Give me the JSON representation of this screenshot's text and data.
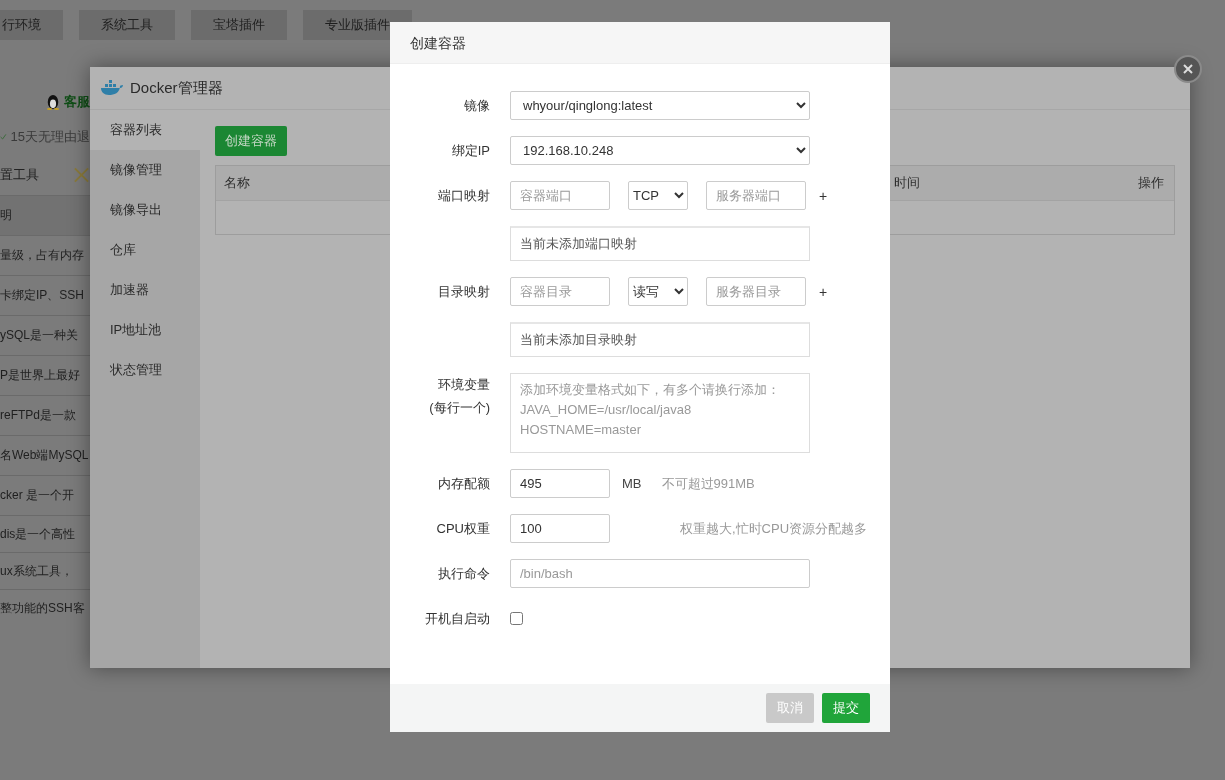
{
  "background_page": {
    "tabs": [
      {
        "label": "行环境"
      },
      {
        "label": "系统工具"
      },
      {
        "label": "宝塔插件"
      },
      {
        "label": "专业版插件"
      }
    ],
    "support": "客服",
    "refund": "15天无理由退",
    "tools": "置工具",
    "column_header": "明",
    "rows": [
      "量级，占有内存",
      "卡绑定IP、SSH",
      "ySQL是一种关",
      "P是世界上最好",
      "reFTPd是一款",
      "名Web端MySQL",
      "cker 是一个开",
      "dis是一个高性",
      "ux系统工具，",
      "整功能的SSH客"
    ]
  },
  "docker_window": {
    "title": "Docker管理器",
    "sidebar": [
      {
        "label": "容器列表",
        "selected": true
      },
      {
        "label": "镜像管理",
        "selected": false
      },
      {
        "label": "镜像导出",
        "selected": false
      },
      {
        "label": "仓库",
        "selected": false
      },
      {
        "label": "加速器",
        "selected": false
      },
      {
        "label": "IP地址池",
        "selected": false
      },
      {
        "label": "状态管理",
        "selected": false
      }
    ],
    "create_button": "创建容器",
    "table": {
      "columns": [
        "名称",
        "时间",
        "操作"
      ]
    }
  },
  "dialog": {
    "title": "创建容器",
    "fields": [
      {
        "kind": "select",
        "label": "镜像",
        "value": "whyour/qinglong:latest"
      },
      {
        "kind": "select",
        "label": "绑定IP",
        "value": "192.168.10.248"
      },
      {
        "kind": "mapping",
        "label": "端口映射",
        "source_placeholder": "容器端口",
        "mode": "TCP",
        "target_placeholder": "服务器端口",
        "add": "+",
        "empty_text": "当前未添加端口映射"
      },
      {
        "kind": "mapping",
        "label": "目录映射",
        "source_placeholder": "容器目录",
        "mode": "读写",
        "target_placeholder": "服务器目录",
        "add": "+",
        "empty_text": "当前未添加目录映射"
      },
      {
        "kind": "textarea",
        "label": "环境变量",
        "sublabel": "(每行一个)",
        "placeholder": "添加环境变量格式如下，有多个请换行添加：\nJAVA_HOME=/usr/local/java8\nHOSTNAME=master"
      },
      {
        "kind": "number",
        "label": "内存配额",
        "value": "495",
        "unit": "MB",
        "hint": "不可超过991MB"
      },
      {
        "kind": "number",
        "label": "CPU权重",
        "value": "100",
        "hint": "权重越大,忙时CPU资源分配越多"
      },
      {
        "kind": "text",
        "label": "执行命令",
        "placeholder": "/bin/bash"
      },
      {
        "kind": "checkbox",
        "label": "开机自启动",
        "checked": false
      }
    ],
    "buttons": [
      {
        "label": "取消",
        "kind": "cancel"
      },
      {
        "label": "提交",
        "kind": "submit"
      }
    ]
  }
}
